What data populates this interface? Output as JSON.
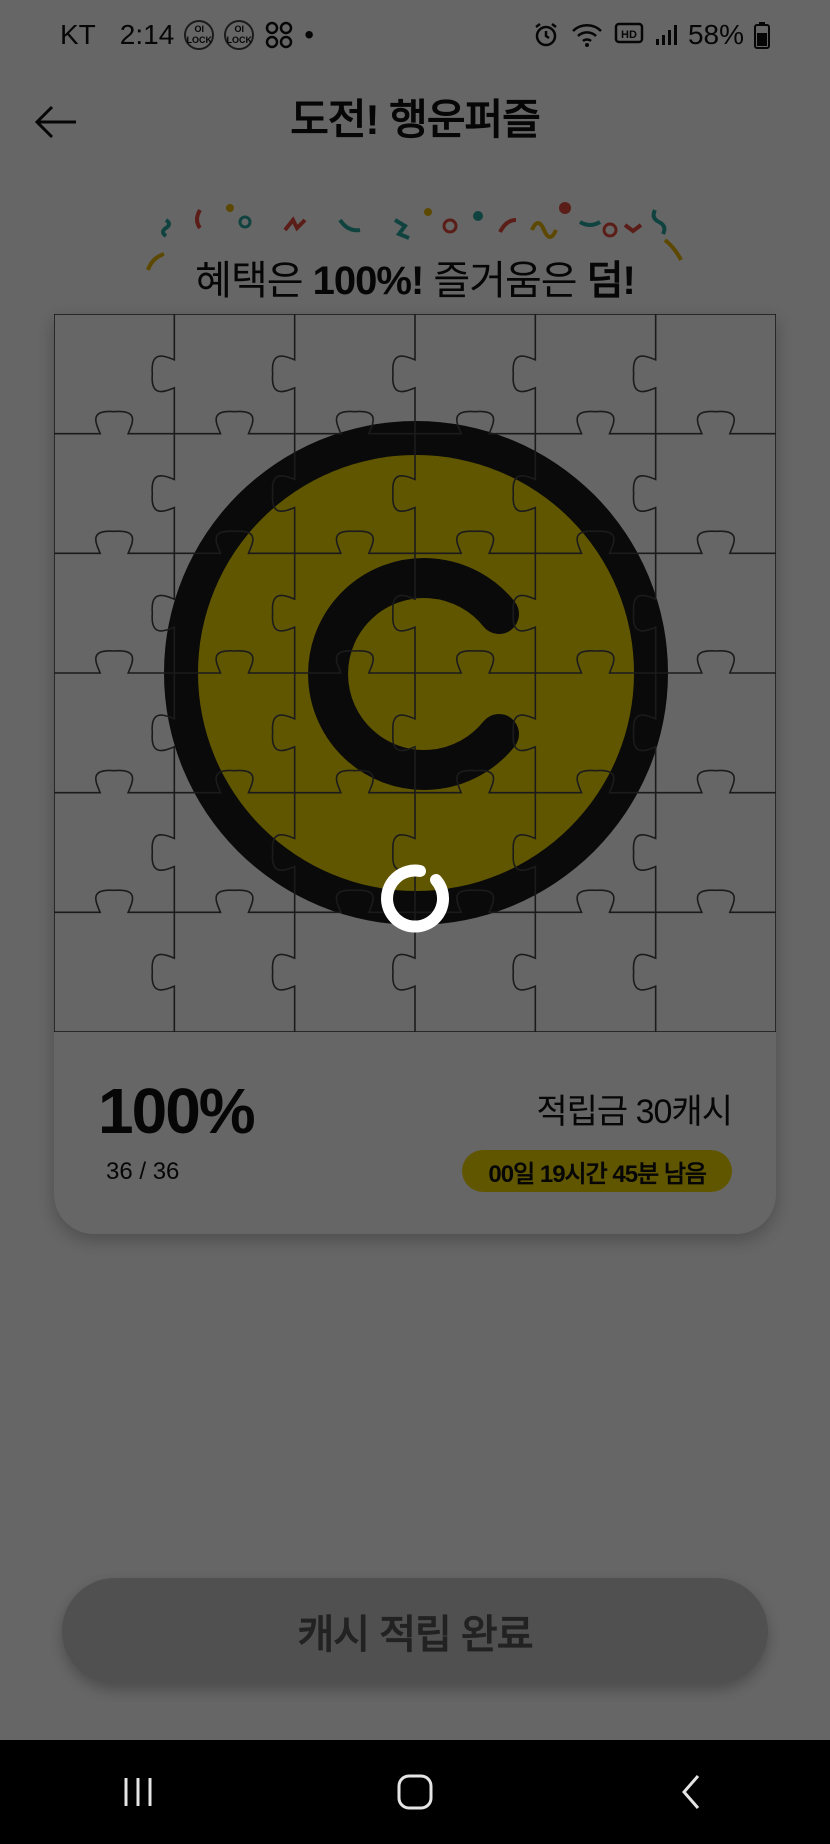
{
  "status_bar": {
    "carrier": "KT",
    "time": "2:14",
    "badge_1": "OI LOCK",
    "badge_2": "OI LOCK",
    "dot": "•",
    "battery": "58%"
  },
  "header": {
    "title": "도전! 행운퍼즐"
  },
  "banner": {
    "prefix": "혜택은 ",
    "strong_1": "100%!",
    "middle": " 즐거움은 ",
    "strong_2": "덤!"
  },
  "puzzle": {
    "grid_columns": 6,
    "grid_rows": 6,
    "logo_letter": "C",
    "logo_color": "#f2d700",
    "ring_color": "#1a1a1a"
  },
  "progress": {
    "percent": "100%",
    "count": "36 / 36",
    "fraction_complete": 1.0
  },
  "reward": {
    "label": "적립금 30캐시",
    "timer": "00일 19시간 45분 남음"
  },
  "action": {
    "complete_label": "캐시 적립 완료"
  },
  "overlay": {
    "loading": true
  }
}
